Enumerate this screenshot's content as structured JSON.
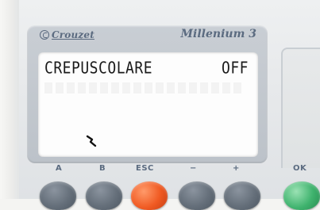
{
  "brand": {
    "name": "Crouzet",
    "model": "Millenium 3"
  },
  "screen": {
    "title": "CREPUSCOLARE",
    "status": "OFF"
  },
  "buttons": [
    {
      "label": "A",
      "name": "a-button"
    },
    {
      "label": "B",
      "name": "b-button"
    },
    {
      "label": "ESC",
      "name": "esc-button"
    },
    {
      "label": "−",
      "name": "minus-button"
    },
    {
      "label": "+",
      "name": "plus-button"
    },
    {
      "label": "OK",
      "name": "ok-button"
    }
  ],
  "colors": {
    "esc_button": "#f05a22",
    "ok_button": "#3fb36e",
    "keypad_button": "#656f7a",
    "brand_text": "#5b6b80"
  }
}
